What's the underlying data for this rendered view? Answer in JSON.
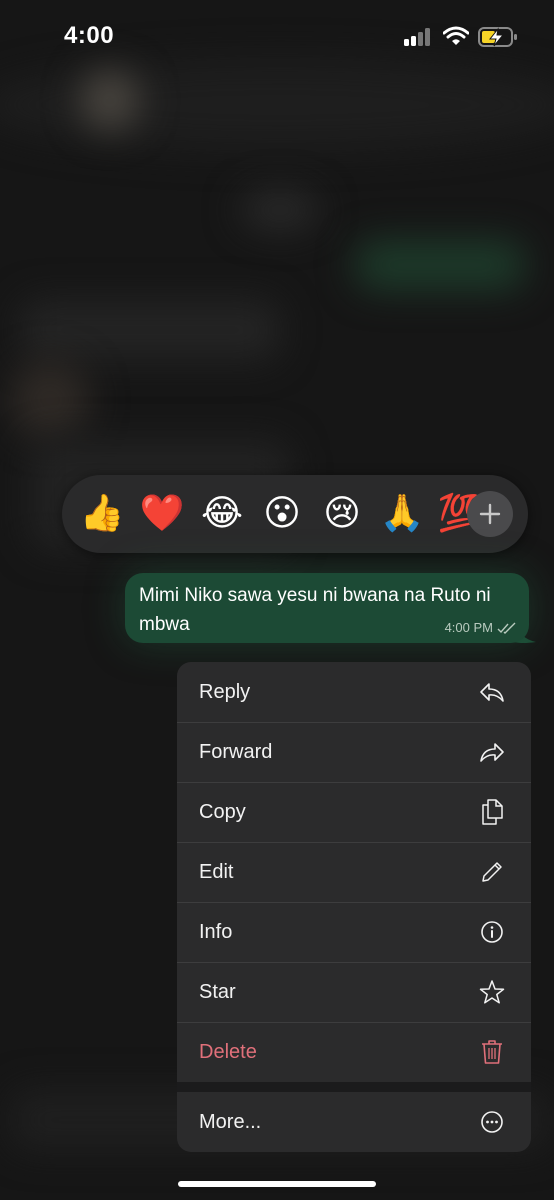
{
  "status_bar": {
    "time": "4:00"
  },
  "reactions": {
    "emojis": [
      {
        "name": "thumbs-up",
        "char": "👍"
      },
      {
        "name": "red-heart",
        "char": "❤️"
      },
      {
        "name": "tears-of-joy",
        "char": "😂"
      },
      {
        "name": "surprised",
        "char": "😮"
      },
      {
        "name": "crying",
        "char": "😢"
      },
      {
        "name": "folded-hands",
        "char": "🙏"
      },
      {
        "name": "hundred-points",
        "char": "💯"
      }
    ],
    "more_icon": "plus-icon"
  },
  "message": {
    "text": "Mimi Niko sawa yesu ni bwana na Ruto ni mbwa",
    "time": "4:00 PM",
    "read_icon": "double-check-icon"
  },
  "menu": {
    "items": [
      {
        "label": "Reply",
        "icon": "reply-icon"
      },
      {
        "label": "Forward",
        "icon": "forward-icon"
      },
      {
        "label": "Copy",
        "icon": "copy-icon"
      },
      {
        "label": "Edit",
        "icon": "pencil-icon"
      },
      {
        "label": "Info",
        "icon": "info-icon"
      },
      {
        "label": "Star",
        "icon": "star-icon"
      },
      {
        "label": "Delete",
        "icon": "trash-icon"
      },
      {
        "label": "More...",
        "icon": "more-icon"
      }
    ]
  },
  "colors": {
    "bubble": "#1c4a35",
    "menu_bg": "#2b2b2c",
    "delete": "#e0707a"
  }
}
